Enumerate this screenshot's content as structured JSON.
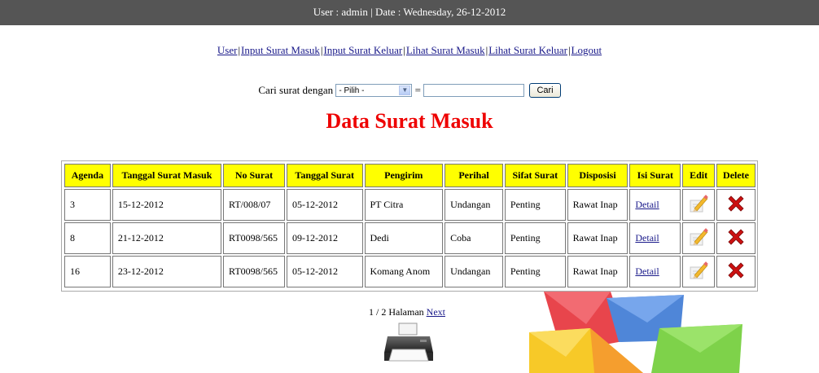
{
  "header": {
    "info": "User : admin | Date : Wednesday, 26-12-2012"
  },
  "nav": {
    "items": [
      "User",
      "Input Surat Masuk",
      "Input Surat Keluar",
      "Lihat Surat Masuk",
      "Lihat Surat Keluar",
      "Logout"
    ]
  },
  "search": {
    "label": "Cari surat dengan",
    "select_value": "- Pilih -",
    "equals": "=",
    "input_value": "",
    "button": "Cari"
  },
  "page_title": "Data Surat Masuk",
  "table": {
    "headers": [
      "Agenda",
      "Tanggal Surat Masuk",
      "No Surat",
      "Tanggal Surat",
      "Pengirim",
      "Perihal",
      "Sifat Surat",
      "Disposisi",
      "Isi Surat",
      "Edit",
      "Delete"
    ],
    "rows": [
      {
        "agenda": "3",
        "tanggal_masuk": "15-12-2012",
        "no_surat": "RT/008/07",
        "tanggal_surat": "05-12-2012",
        "pengirim": "PT Citra",
        "perihal": "Undangan",
        "sifat": "Penting",
        "disposisi": "Rawat Inap",
        "isi": "Detail"
      },
      {
        "agenda": "8",
        "tanggal_masuk": "21-12-2012",
        "no_surat": "RT0098/565",
        "tanggal_surat": "09-12-2012",
        "pengirim": "Dedi",
        "perihal": "Coba",
        "sifat": "Penting",
        "disposisi": "Rawat Inap",
        "isi": "Detail"
      },
      {
        "agenda": "16",
        "tanggal_masuk": "23-12-2012",
        "no_surat": "RT0098/565",
        "tanggal_surat": "05-12-2012",
        "pengirim": "Komang Anom",
        "perihal": "Undangan",
        "sifat": "Penting",
        "disposisi": "Rawat Inap",
        "isi": "Detail"
      }
    ]
  },
  "pager": {
    "text": "1 / 2 Halaman",
    "next": "Next"
  },
  "icons": {
    "edit": "edit-pencil-icon",
    "delete": "delete-x-icon",
    "print": "printer-icon",
    "decor": "envelopes-image"
  },
  "colors": {
    "topbar": "#555555",
    "title": "#ee0000",
    "header_bg": "#ffff00",
    "delete": "#cc1111"
  }
}
